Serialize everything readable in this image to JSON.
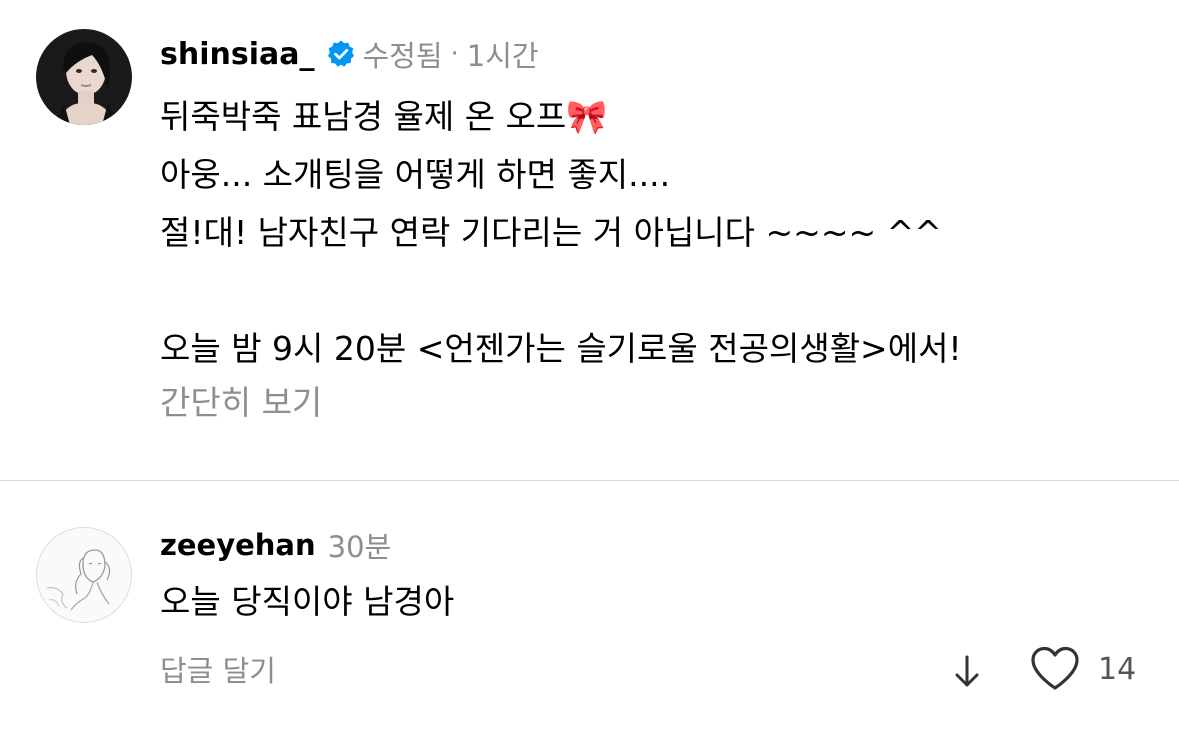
{
  "caption": {
    "username": "shinsiaa_",
    "edited": "수정됨",
    "separator": "·",
    "time": "1시간",
    "lines": [
      "뒤죽박죽 표남경 율제 온 오프🎀",
      "아웅... 소개팅을 어떻게 하면 좋지....",
      "절!대! 남자친구 연락 기다리는 거 아닙니다 ~~~~ ^^",
      "",
      "오늘 밤 9시 20분 <언젠가는 슬기로울 전공의생활>에서!"
    ],
    "see_less": "간단히 보기"
  },
  "comment": {
    "username": "zeeyehan",
    "time": "30분",
    "text": "오늘 당직이야 남경아",
    "reply_label": "답글 달기",
    "like_count": "14"
  },
  "colors": {
    "verified_badge": "#0095f6",
    "secondary_text": "#8e8e8e",
    "divider": "#dbdbdb"
  }
}
